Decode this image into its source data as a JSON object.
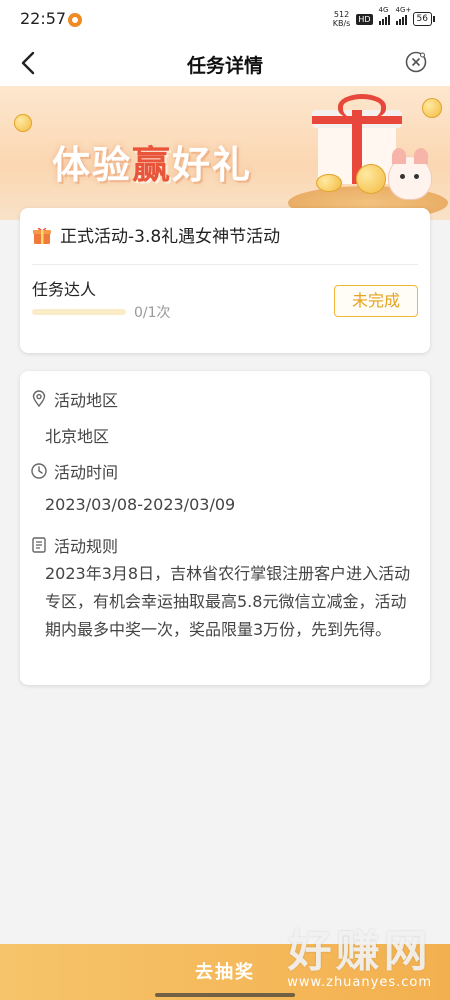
{
  "status_bar": {
    "time": "22:57",
    "net_speed_value": "512",
    "net_speed_unit": "KB/s",
    "hd_label": "HD",
    "sim1_label": "4G",
    "sim2_label": "4G+",
    "battery": "56"
  },
  "nav": {
    "title": "任务详情",
    "back_icon": "chevron-left-icon",
    "close_icon": "close-circle-icon"
  },
  "banner": {
    "title_part1": "体验",
    "title_highlight": "赢",
    "title_part2": "好礼"
  },
  "task_card": {
    "title": "正式活动-3.8礼遇女神节活动",
    "task_name": "任务达人",
    "progress_text": "0/1次",
    "progress_fraction": 0,
    "status_button": "未完成"
  },
  "info_card": {
    "region_label": "活动地区",
    "region_value": "北京地区",
    "time_label": "活动时间",
    "time_value": "2023/03/08-2023/03/09",
    "rules_label": "活动规则",
    "rules_text": "2023年3月8日，吉林省农行掌银注册客户进入活动专区，有机会幸运抽取最高5.8元微信立减金，活动期内最多中奖一次，奖品限量3万份，先到先得。"
  },
  "bottom": {
    "button_label": "去抽奖"
  },
  "watermark": {
    "big_text": "好赚网",
    "url_text": "www.zhuanyes.com"
  },
  "colors": {
    "accent": "#f0b73a",
    "accent_text": "#e6a21f",
    "banner_highlight": "#e8553a"
  }
}
